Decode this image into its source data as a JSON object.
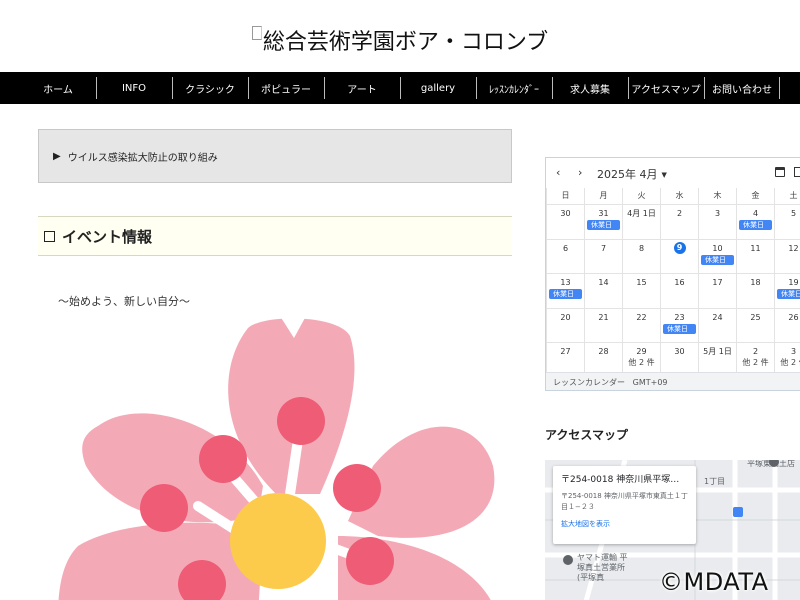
{
  "header": {
    "site_title": "総合芸術学園ボア・コロンブ"
  },
  "nav": {
    "items": [
      {
        "label": "ホーム"
      },
      {
        "label": "INFO"
      },
      {
        "label": "クラシック"
      },
      {
        "label": "ポピュラー"
      },
      {
        "label": "アート"
      },
      {
        "label": "gallery"
      },
      {
        "label": "ﾚｯｽﾝｶﾚﾝﾀﾞｰ"
      },
      {
        "label": "求人募集"
      },
      {
        "label": "アクセスマップ"
      },
      {
        "label": "お問い合わせ"
      }
    ]
  },
  "main": {
    "accordion_label": "ウイルス感染拡大防止の取り組み",
    "section_title": "イベント情報",
    "tagline": "～始めよう、新しい自分～"
  },
  "calendar": {
    "month_label": "2025年 4月",
    "weekdays": [
      "日",
      "月",
      "火",
      "水",
      "木",
      "金",
      "土"
    ],
    "weeks": [
      [
        "30",
        "31",
        "4月 1日",
        "2",
        "3",
        "4",
        "5"
      ],
      [
        "6",
        "7",
        "8",
        "9",
        "10",
        "11",
        "12"
      ],
      [
        "13",
        "14",
        "15",
        "16",
        "17",
        "18",
        "19"
      ],
      [
        "20",
        "21",
        "22",
        "23",
        "24",
        "25",
        "26"
      ],
      [
        "27",
        "28",
        "29",
        "30",
        "5月 1日",
        "2",
        "3"
      ]
    ],
    "event_label": "休業日",
    "more_label": "他 2 件",
    "footer_label": "レッスンカレンダー",
    "timezone": "GMT+09",
    "accent_color": "#4285f4"
  },
  "map": {
    "title": "アクセスマップ",
    "card_title": "〒254-0018 神奈川県平塚市東…",
    "card_address": "〒254-0018 神奈川県平塚市東真土１丁目１−２３",
    "card_link": "拡大地図を表示",
    "street_1": "平塚東真土店",
    "street_2": "1丁目",
    "poi_label": "ヤマト運輸 平塚真土営業所(平塚真"
  },
  "watermark": "©MDATA"
}
